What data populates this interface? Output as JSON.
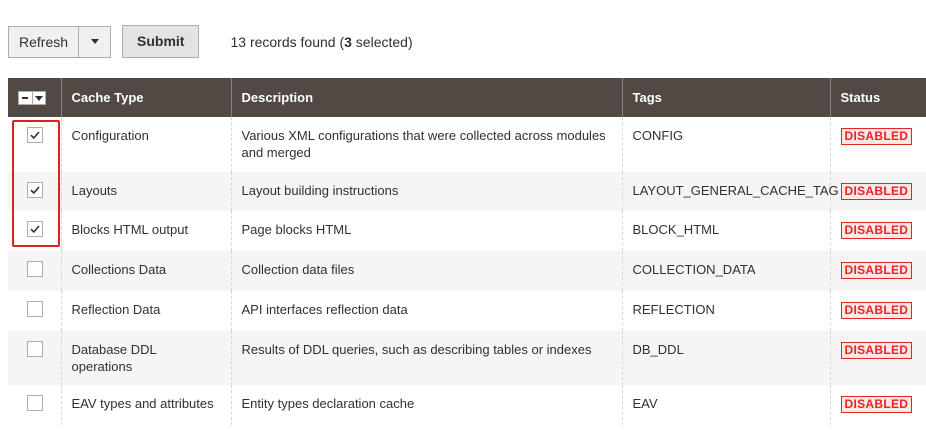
{
  "toolbar": {
    "refresh_label": "Refresh",
    "submit_label": "Submit",
    "records_prefix": "13 records found (",
    "selected_count": "3",
    "records_suffix": " selected)"
  },
  "grid": {
    "columns": {
      "cache_type": "Cache Type",
      "description": "Description",
      "tags": "Tags",
      "status": "Status"
    },
    "rows": [
      {
        "checked": true,
        "cache_type": "Configuration",
        "description": "Various XML configurations that were collected across modules and merged",
        "tags": "CONFIG",
        "status": "DISABLED"
      },
      {
        "checked": true,
        "cache_type": "Layouts",
        "description": "Layout building instructions",
        "tags": "LAYOUT_GENERAL_CACHE_TAG",
        "status": "DISABLED"
      },
      {
        "checked": true,
        "cache_type": "Blocks HTML output",
        "description": "Page blocks HTML",
        "tags": "BLOCK_HTML",
        "status": "DISABLED"
      },
      {
        "checked": false,
        "cache_type": "Collections Data",
        "description": "Collection data files",
        "tags": "COLLECTION_DATA",
        "status": "DISABLED"
      },
      {
        "checked": false,
        "cache_type": "Reflection Data",
        "description": "API interfaces reflection data",
        "tags": "REFLECTION",
        "status": "DISABLED"
      },
      {
        "checked": false,
        "cache_type": "Database DDL operations",
        "description": "Results of DDL queries, such as describing tables or indexes",
        "tags": "DB_DDL",
        "status": "DISABLED"
      },
      {
        "checked": false,
        "cache_type": "EAV types and attributes",
        "description": "Entity types declaration cache",
        "tags": "EAV",
        "status": "DISABLED"
      }
    ]
  },
  "colors": {
    "header_bg": "#514943",
    "status_red": "#e22626",
    "highlight_red": "#e0201b"
  }
}
